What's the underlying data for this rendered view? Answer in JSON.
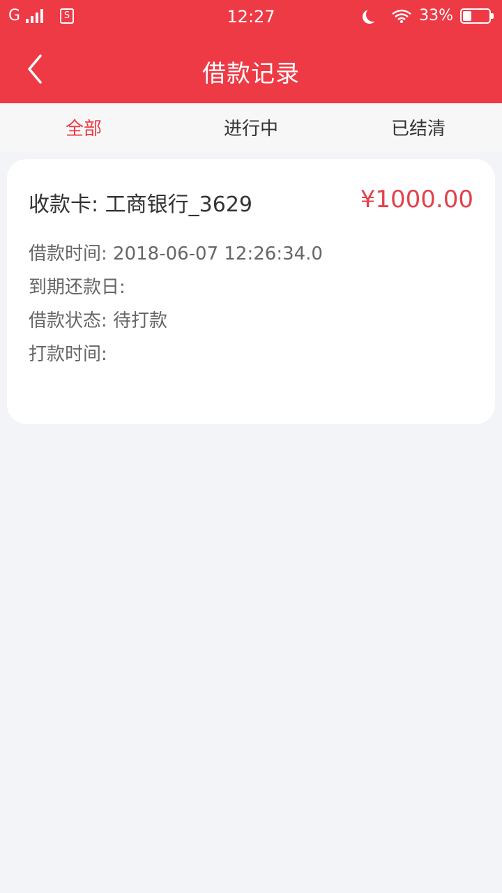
{
  "status_bar": {
    "carrier_label": "G",
    "sim_label": "S",
    "time": "12:27",
    "battery_text": "33%",
    "battery_level": 0.33,
    "icons": [
      "signal-icon",
      "sim-icon",
      "moon-icon",
      "wifi-icon",
      "battery-icon"
    ]
  },
  "header": {
    "title": "借款记录",
    "back_icon": "chevron-left-icon"
  },
  "tabs": [
    {
      "label": "全部",
      "active": true
    },
    {
      "label": "进行中",
      "active": false
    },
    {
      "label": "已结清",
      "active": false
    }
  ],
  "record": {
    "bank_card": "收款卡: 工商银行_3629",
    "amount": "¥1000.00",
    "borrow_time": "借款时间: 2018-06-07 12:26:34.0",
    "due_date": "到期还款日:",
    "status": "借款状态: 待打款",
    "payout_time": "打款时间:"
  },
  "colors": {
    "brand_red": "#ee3a45",
    "amount_red": "#e3414b",
    "background": "#f3f4f8"
  }
}
